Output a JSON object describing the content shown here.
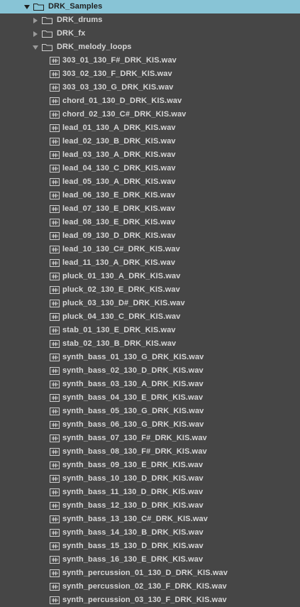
{
  "browser": {
    "root": {
      "label": "DRK_Samples",
      "expanded": true,
      "selected": true
    },
    "folders": [
      {
        "label": "DRK_drums",
        "expanded": false
      },
      {
        "label": "DRK_fx",
        "expanded": false
      },
      {
        "label": "DRK_melody_loops",
        "expanded": true
      }
    ],
    "files": [
      "303_01_130_F#_DRK_KIS.wav",
      "303_02_130_F_DRK_KIS.wav",
      "303_03_130_G_DRK_KIS.wav",
      "chord_01_130_D_DRK_KIS.wav",
      "chord_02_130_C#_DRK_KIS.wav",
      "lead_01_130_A_DRK_KIS.wav",
      "lead_02_130_B_DRK_KIS.wav",
      "lead_03_130_A_DRK_KIS.wav",
      "lead_04_130_C_DRK_KIS.wav",
      "lead_05_130_A_DRK_KIS.wav",
      "lead_06_130_E_DRK_KIS.wav",
      "lead_07_130_E_DRK_KIS.wav",
      "lead_08_130_E_DRK_KIS.wav",
      "lead_09_130_D_DRK_KIS.wav",
      "lead_10_130_C#_DRK_KIS.wav",
      "lead_11_130_A_DRK_KIS.wav",
      "pluck_01_130_A_DRK_KIS.wav",
      "pluck_02_130_E_DRK_KIS.wav",
      "pluck_03_130_D#_DRK_KIS.wav",
      "pluck_04_130_C_DRK_KIS.wav",
      "stab_01_130_E_DRK_KIS.wav",
      "stab_02_130_B_DRK_KIS.wav",
      "synth_bass_01_130_G_DRK_KIS.wav",
      "synth_bass_02_130_D_DRK_KIS.wav",
      "synth_bass_03_130_A_DRK_KIS.wav",
      "synth_bass_04_130_E_DRK_KIS.wav",
      "synth_bass_05_130_G_DRK_KIS.wav",
      "synth_bass_06_130_G_DRK_KIS.wav",
      "synth_bass_07_130_F#_DRK_KIS.wav",
      "synth_bass_08_130_F#_DRK_KIS.wav",
      "synth_bass_09_130_E_DRK_KIS.wav",
      "synth_bass_10_130_D_DRK_KIS.wav",
      "synth_bass_11_130_D_DRK_KIS.wav",
      "synth_bass_12_130_D_DRK_KIS.wav",
      "synth_bass_13_130_C#_DRK_KIS.wav",
      "synth_bass_14_130_B_DRK_KIS.wav",
      "synth_bass_15_130_D_DRK_KIS.wav",
      "synth_bass_16_130_E_DRK_KIS.wav",
      "synth_percussion_01_130_D_DRK_KIS.wav",
      "synth_percussion_02_130_F_DRK_KIS.wav",
      "synth_percussion_03_130_F_DRK_KIS.wav"
    ]
  },
  "colors": {
    "background": "#464646",
    "selection": "#88c4d6",
    "text": "#d6d6d6",
    "icon": "#d0d0d0"
  },
  "icons": {
    "folder": "folder-icon",
    "file": "audio-waveform-icon",
    "expanded": "chevron-down-icon",
    "collapsed": "chevron-right-icon"
  }
}
